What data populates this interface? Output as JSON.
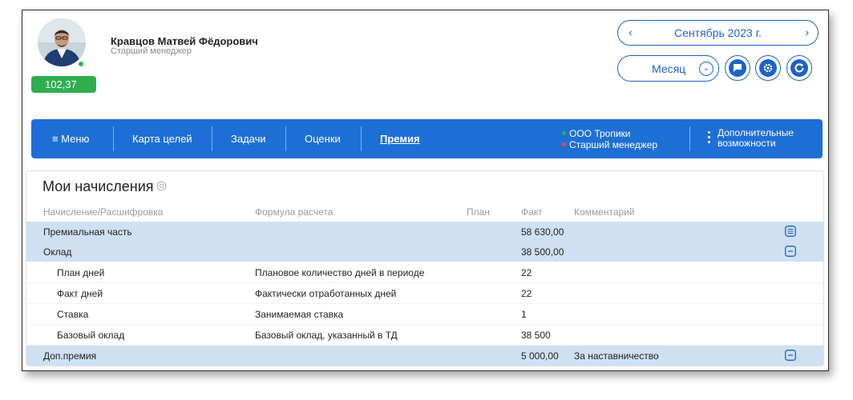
{
  "user": {
    "name": "Кравцов Матвей Фёдорович",
    "role": "Старший менеджер",
    "score": "102,37"
  },
  "period": {
    "label": "Сентябрь 2023 г.",
    "prev_arrow": "‹",
    "next_arrow": "›"
  },
  "view_mode": {
    "selected": "Месяц"
  },
  "nav": {
    "menu_label": "≡  Меню",
    "items": [
      "Карта целей",
      "Задачи",
      "Оценки",
      "Премия"
    ],
    "active": "Премия",
    "organization": "ООО Тропики",
    "position": "Старший менеджер",
    "extra_line1": "Дополнительные",
    "extra_line2": "возможности",
    "org_dot_color": "#2bb24c",
    "position_dot_color": "#e84a3c"
  },
  "accruals": {
    "title": "Мои начисления",
    "columns": {
      "name": "Начисление/Расшифровка",
      "formula": "Формула расчета",
      "plan": "План",
      "fact": "Факт",
      "comment": "Комментарий"
    },
    "rows": [
      {
        "name": "Премиальная часть",
        "formula": "",
        "plan": "",
        "fact": "58 630,00",
        "comment": "",
        "type": "group",
        "icon": "list-icon"
      },
      {
        "name": "Оклад",
        "formula": "",
        "plan": "",
        "fact": "38 500,00",
        "comment": "",
        "type": "group",
        "icon": "collapse-icon"
      },
      {
        "name": "План дней",
        "formula": "Плановое количество дней в периоде",
        "plan": "",
        "fact": "22",
        "comment": "",
        "type": "detail"
      },
      {
        "name": "Факт дней",
        "formula": "Фактически отработанных дней",
        "plan": "",
        "fact": "22",
        "comment": "",
        "type": "detail"
      },
      {
        "name": "Ставка",
        "formula": "Занимаемая ставка",
        "plan": "",
        "fact": "1",
        "comment": "",
        "type": "detail"
      },
      {
        "name": "Базовый оклад",
        "formula": "Базовый оклад, указанный в ТД",
        "plan": "",
        "fact": "38 500",
        "comment": "",
        "type": "detail"
      },
      {
        "name": "Доп.премия",
        "formula": "",
        "plan": "",
        "fact": "5 000,00",
        "comment": "За наставничество",
        "type": "group",
        "icon": "collapse-icon"
      }
    ]
  },
  "colors": {
    "accent": "#1d63c6",
    "navbar": "#1d6fd6",
    "band": "#cfe0f3",
    "score_badge": "#2fae4f"
  }
}
